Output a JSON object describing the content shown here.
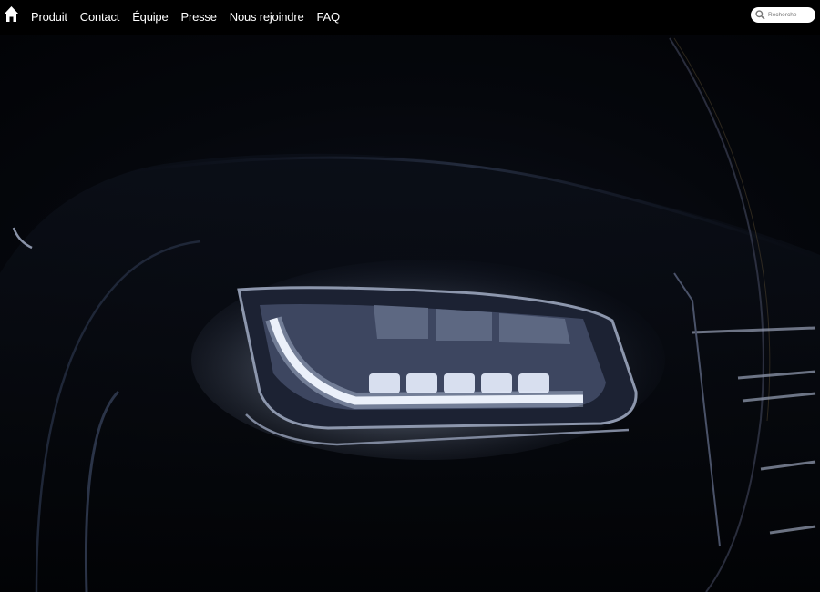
{
  "nav": {
    "home_icon": "home-icon",
    "items": [
      {
        "label": "Produit"
      },
      {
        "label": "Contact"
      },
      {
        "label": "Équipe"
      },
      {
        "label": "Presse"
      },
      {
        "label": "Nous rejoindre"
      },
      {
        "label": "FAQ"
      }
    ]
  },
  "search": {
    "placeholder": "Recherche",
    "icon": "search-icon"
  },
  "hero": {
    "subject": "car-headlight-image"
  }
}
